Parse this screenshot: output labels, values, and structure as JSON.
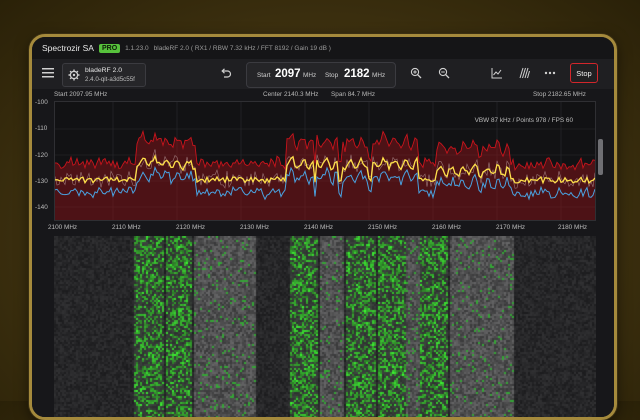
{
  "app": {
    "name": "Spectrozir SA",
    "badge": "PRO",
    "version": "1.1.23.0",
    "info": "bladeRF 2.0  ( RX1 / RBW 7.32 kHz / FFT 8192 / Gain 19 dB )"
  },
  "device": {
    "name": "bladeRF 2.0",
    "serial": "2.4.0-qit-a3d5c55f"
  },
  "freq": {
    "start_label": "Start",
    "start_value": "2097",
    "unit": "MHz",
    "stop_label": "Stop",
    "stop_value": "2182"
  },
  "stop_button": "Stop",
  "spectrum": {
    "start": "Start 2097.95 MHz",
    "center": "Center 2140.3 MHz",
    "span": "Span 84.7 MHz",
    "stop": "Stop 2182.65 MHz",
    "status": "VBW 87 kHz / Points 978 / FPS 60",
    "y_ticks": [
      "-100",
      "-110",
      "-120",
      "-130",
      "-140"
    ],
    "x_ticks": [
      "2100 MHz",
      "2110 MHz",
      "2120 MHz",
      "2130 MHz",
      "2140 MHz",
      "2150 MHz",
      "2160 MHz",
      "2170 MHz",
      "2180 MHz"
    ]
  },
  "colors": {
    "accent_green": "#57c23c",
    "stop_border": "#d2262b",
    "max_hold": "#c8141c",
    "avg": "#ffe04a",
    "min_hold": "#4aa2e0",
    "gold_bezel": "#a58a3c"
  }
}
